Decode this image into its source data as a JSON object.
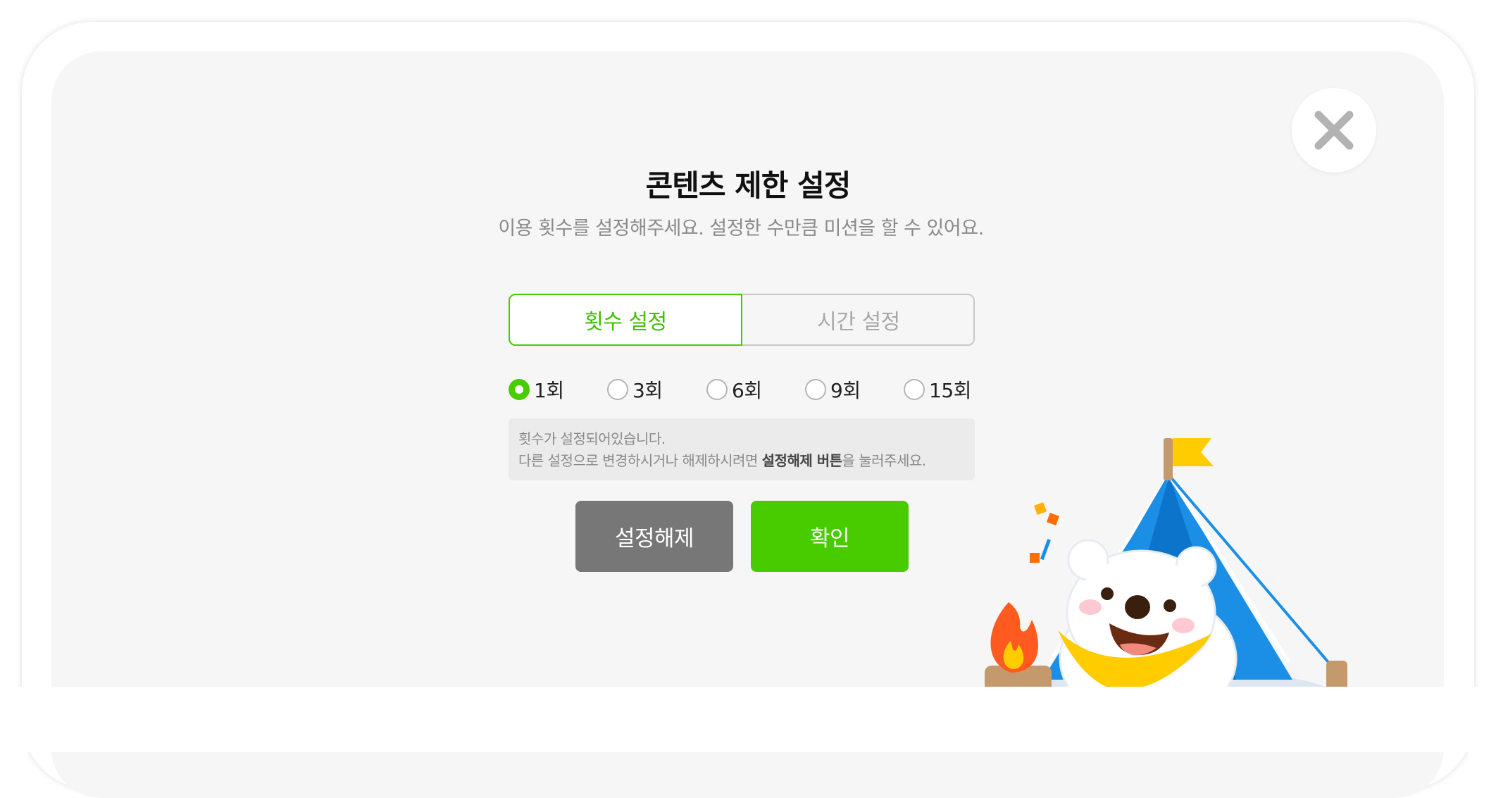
{
  "dialog": {
    "title": "콘텐츠 제한 설정",
    "subtitle": "이용 횟수를 설정해주세요. 설정한 수만큼 미션을 할 수 있어요.",
    "close_icon": "close-icon"
  },
  "tabs": [
    {
      "label": "횟수 설정",
      "active": true
    },
    {
      "label": "시간 설정",
      "active": false
    }
  ],
  "count_options": [
    {
      "label": "1회",
      "checked": true
    },
    {
      "label": "3회",
      "checked": false
    },
    {
      "label": "6회",
      "checked": false
    },
    {
      "label": "9회",
      "checked": false
    },
    {
      "label": "15회",
      "checked": false
    }
  ],
  "notice": {
    "line1": "횟수가 설정되어있습니다.",
    "line2_prefix": "다른 설정으로 변경하시거나 해제하시려면 ",
    "line2_bold": "설정해제 버튼",
    "line2_suffix": "을 눌러주세요."
  },
  "buttons": {
    "release": "설정해제",
    "confirm": "확인"
  },
  "colors": {
    "accent": "#48cc00",
    "release_button": "#777777",
    "panel_bg": "#f6f6f6"
  }
}
